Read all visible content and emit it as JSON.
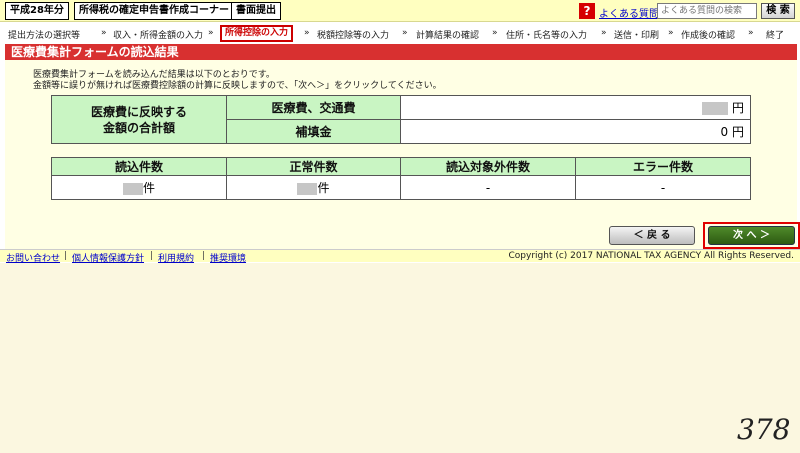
{
  "header": {
    "year": "平成28年分",
    "corner": "所得税の確定申告書作成コーナー",
    "paper_submit": "書面提出",
    "help_icon": "?",
    "faq_link": "よくある質問",
    "search_placeholder": "よくある質問の検索",
    "search_button": "検 索"
  },
  "steps": [
    "提出方法の選択等",
    "収入・所得金額の入力",
    "所得控除の入力",
    "税額控除等の入力",
    "計算結果の確認",
    "住所・氏名等の入力",
    "送信・印刷",
    "作成後の確認",
    "終了"
  ],
  "step_arrow": "»",
  "section_title": "医療費集計フォームの読込結果",
  "description": [
    "医療費集計フォームを読み込んだ結果は以下のとおりです。",
    "金額等に誤りが無ければ医療費控除額の計算に反映しますので、「次へ＞」をクリックしてください。"
  ],
  "summary": {
    "label_line1": "医療費に反映する",
    "label_line2": "金額の合計額",
    "row1_label": "医療費、交通費",
    "row1_unit": "円",
    "row2_label": "補填金",
    "row2_value": "0 円"
  },
  "counts": {
    "headers": [
      "読込件数",
      "正常件数",
      "読込対象外件数",
      "エラー件数"
    ],
    "unit": "件",
    "excluded": "-",
    "errors": "-"
  },
  "buttons": {
    "back": "＜ 戻 る",
    "next": "次 へ ＞"
  },
  "footer": {
    "links": [
      "お問い合わせ",
      "個人情報保護方針",
      "利用規約",
      "推奨環境"
    ],
    "separator": "|",
    "copyright": "Copyright (c) 2017 NATIONAL TAX AGENCY All Rights Reserved."
  },
  "page_number": "378"
}
